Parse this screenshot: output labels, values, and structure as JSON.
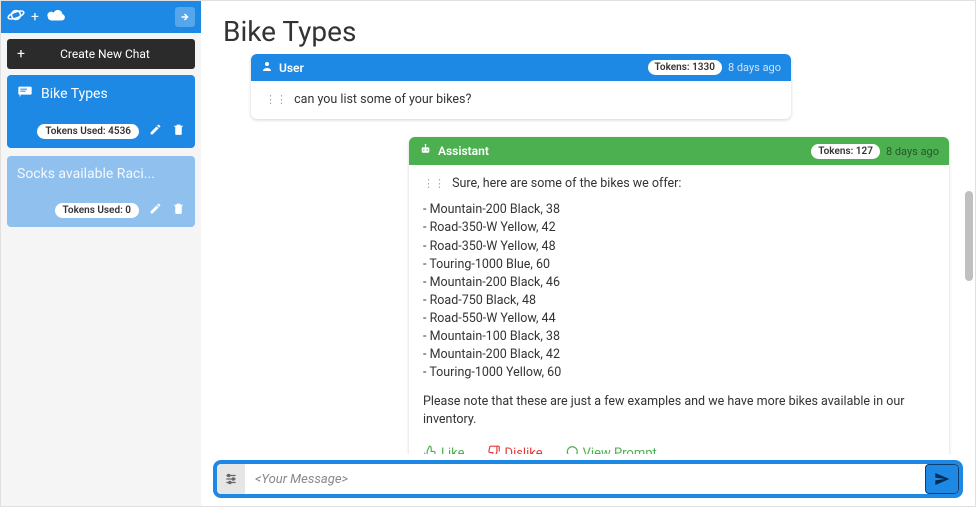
{
  "sidebar": {
    "brand_plus": "+",
    "new_chat_label": "Create New Chat",
    "chats": [
      {
        "title": "Bike Types",
        "tokens_label": "Tokens Used: 4536",
        "active": true
      },
      {
        "title": "Socks available Raci...",
        "tokens_label": "Tokens Used: 0",
        "active": false
      }
    ]
  },
  "page": {
    "title": "Bike Types"
  },
  "messages": {
    "user": {
      "role_label": "User",
      "tokens_label": "Tokens: 1330",
      "time": "8 days ago",
      "text": "can you list some of your bikes?"
    },
    "assistant": {
      "role_label": "Assistant",
      "tokens_label": "Tokens: 127",
      "time": "8 days ago",
      "intro": "Sure, here are some of the bikes we offer:",
      "bikes": [
        "Mountain-200 Black, 38",
        "Road-350-W Yellow, 42",
        "Road-350-W Yellow, 48",
        "Touring-1000 Blue, 60",
        "Mountain-200 Black, 46",
        "Road-750 Black, 48",
        "Road-550-W Yellow, 44",
        "Mountain-100 Black, 38",
        "Mountain-200 Black, 42",
        "Touring-1000 Yellow, 60"
      ],
      "note": "Please note that these are just a few examples and we have more bikes available in our inventory.",
      "actions": {
        "like": "Like",
        "dislike": "Dislike",
        "view_prompt": "View Prompt"
      }
    }
  },
  "composer": {
    "placeholder": "<Your Message>"
  }
}
